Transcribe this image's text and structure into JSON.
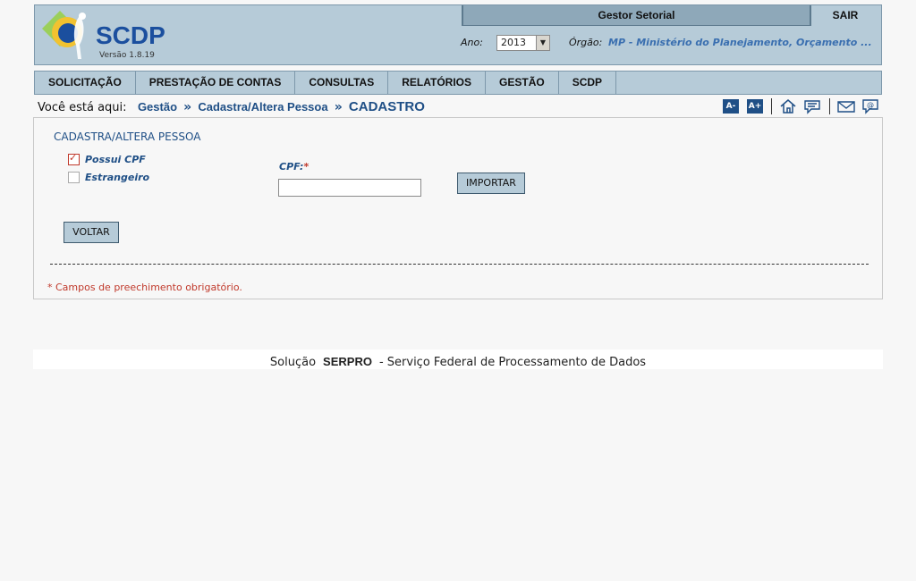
{
  "header": {
    "logo_text": "SCDP",
    "version": "Versão 1.8.19",
    "profile": "Gestor Setorial",
    "logout_label": "SAIR",
    "year_label": "Ano:",
    "year_value": "2013",
    "org_label": "Órgão:",
    "org_value": "MP - Ministério do Planejamento, Orçamento ..."
  },
  "nav": {
    "items": [
      {
        "label": "SOLICITAÇÃO"
      },
      {
        "label": "PRESTAÇÃO DE CONTAS"
      },
      {
        "label": "CONSULTAS"
      },
      {
        "label": "RELATÓRIOS"
      },
      {
        "label": "GESTÃO"
      },
      {
        "label": "SCDP"
      }
    ]
  },
  "breadcrumb": {
    "prefix": "Você está aqui:",
    "items": [
      "Gestão",
      "Cadastra/Altera Pessoa"
    ],
    "current": "CADASTRO"
  },
  "tools": {
    "font_decrease": "A-",
    "font_increase": "A+",
    "icons": [
      "home-icon",
      "comment-icon",
      "mail-icon",
      "contact-icon"
    ]
  },
  "form": {
    "title": "CADASTRA/ALTERA PESSOA",
    "checkbox_cpf": {
      "label": "Possui CPF",
      "checked": true
    },
    "checkbox_foreign": {
      "label": "Estrangeiro",
      "checked": false
    },
    "cpf_label": "CPF:",
    "cpf_required_mark": "*",
    "cpf_value": "",
    "import_button": "IMPORTAR",
    "back_button": "VOLTAR",
    "required_note": "* Campos de preechimento obrigatório."
  },
  "footer": {
    "prefix": "Solução",
    "brand": "SERPRO",
    "suffix": "- Serviço Federal de Processamento de Dados"
  },
  "colors": {
    "header_bg": "#b6cbd8",
    "link_blue": "#1f4f86",
    "required_red": "#c0392b"
  }
}
